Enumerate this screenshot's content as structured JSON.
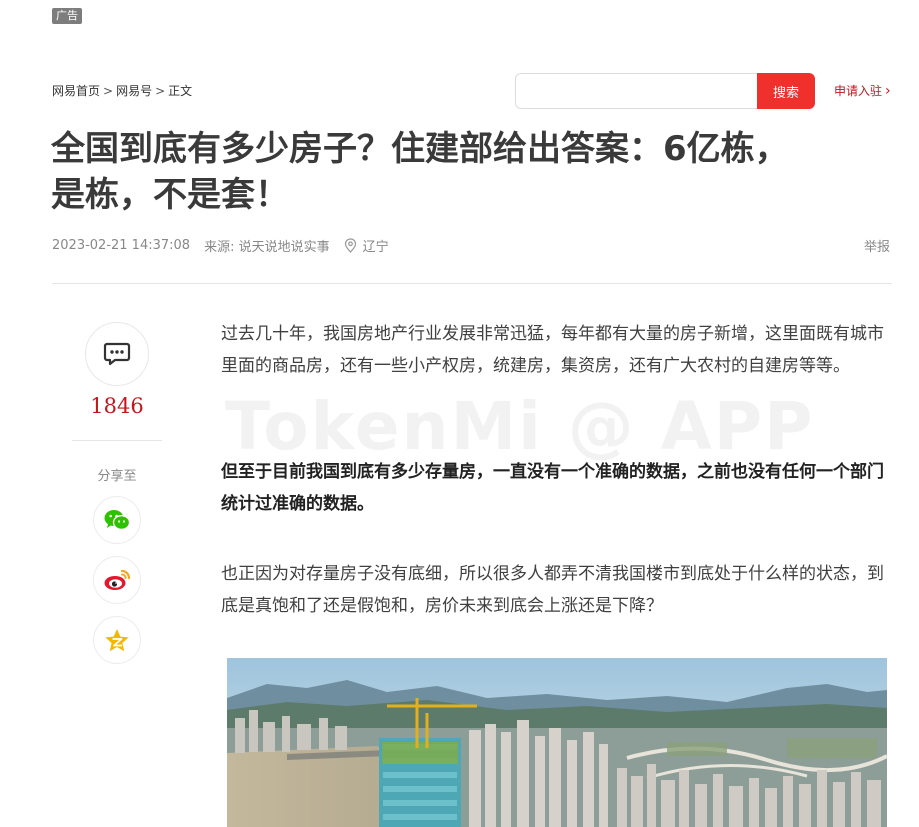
{
  "ad": {
    "label": "广告"
  },
  "breadcrumb": {
    "items": [
      "网易首页",
      "网易号",
      "正文"
    ],
    "separator": ">"
  },
  "search": {
    "placeholder": "",
    "value": "",
    "button_label": "搜索"
  },
  "apply": {
    "label": "申请入驻"
  },
  "article": {
    "title_line1": "全国到底有多少房子？住建部给出答案：6亿栋，",
    "title_line2": "是栋，不是套！",
    "datetime": "2023-02-21 14:37:08",
    "source": "来源: 说天说地说实事",
    "location": "辽宁",
    "report_label": "举报",
    "paragraphs": [
      "过去几十年，我国房地产行业发展非常迅猛，每年都有大量的房子新增，这里面既有城市里面的商品房，还有一些小产权房，统建房，集资房，还有广大农村的自建房等等。",
      "但至于目前我国到底有多少存量房，一直没有一个准确的数据，之前也没有任何一个部门统计过准确的数据。",
      "也正因为对存量房子没有底细，所以很多人都弄不清我国楼市到底处于什么样的状态，到底是真饱和了还是假饱和，房价未来到底会上涨还是下降？"
    ]
  },
  "sidebar": {
    "comment_count": "1846",
    "share_label": "分享至",
    "share_targets": [
      "wechat-icon",
      "weibo-icon",
      "qzone-icon"
    ]
  },
  "watermark": "TokenMi @ APP",
  "colors": {
    "accent_red": "#f0302d",
    "link_red": "#c4161c",
    "wechat_green": "#2dc100",
    "weibo_red": "#e6162d",
    "qzone_yellow": "#f5b800"
  }
}
